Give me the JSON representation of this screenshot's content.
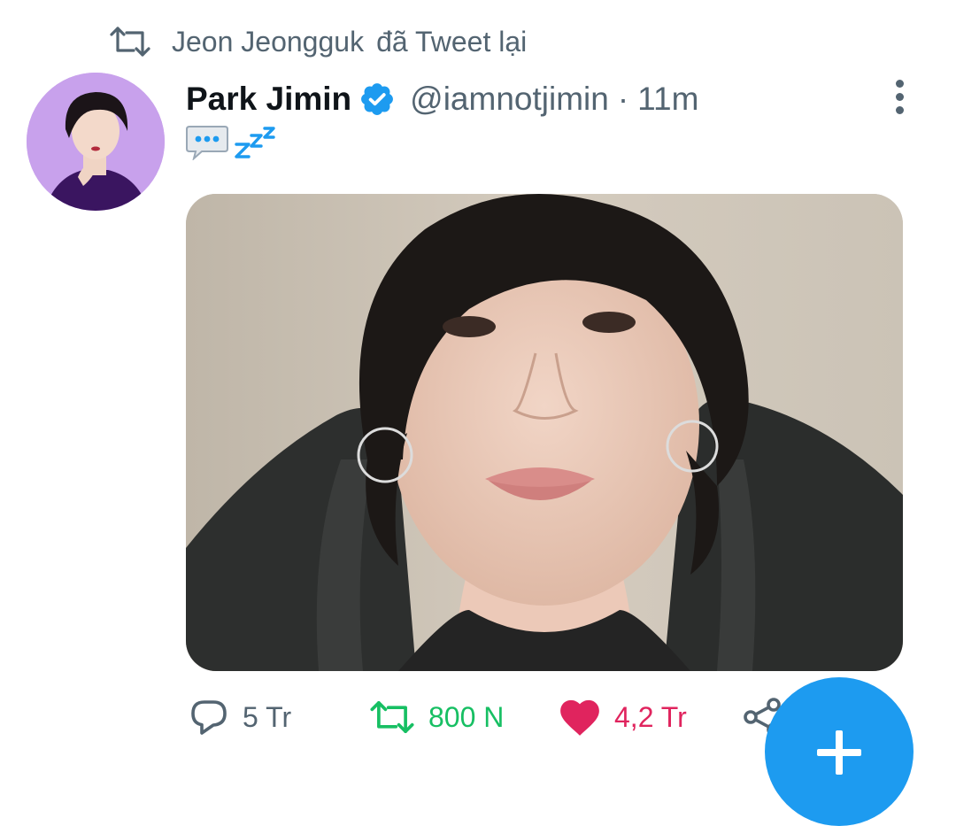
{
  "retweet_context": {
    "icon": "retweet-icon",
    "user": "Jeon Jeongguk",
    "action": "đã Tweet lại"
  },
  "tweet": {
    "display_name": "Park Jimin",
    "verified_icon": "verified-badge-icon",
    "handle": "@iamnotjimin",
    "separator": "·",
    "time": "11m",
    "text_emoji": [
      "speech-balloon-icon",
      "zzz-icon"
    ],
    "media": "photo"
  },
  "actions": {
    "reply_count": "5 Tr",
    "retweet_count": "800 N",
    "like_count": "4,2 Tr",
    "liked": true,
    "retweeted": true
  },
  "colors": {
    "accent": "#1d9bf0",
    "retweet_green": "#17bf63",
    "like_pink": "#e0245e",
    "secondary_text": "#536471"
  }
}
